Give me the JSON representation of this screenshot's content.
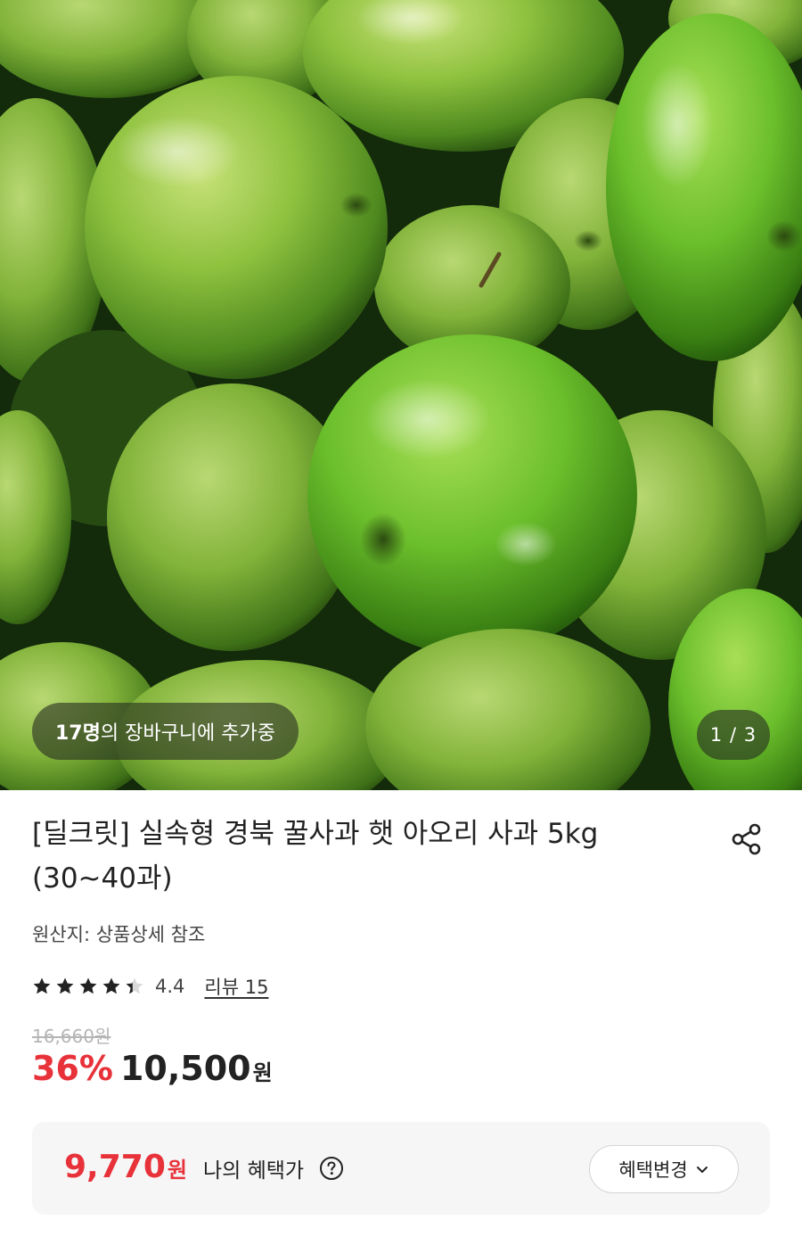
{
  "hero": {
    "image": "green-apples-photo",
    "cart_count": "17명",
    "cart_text": "의 장바구니에 추가중",
    "page_indicator": "1 / 3",
    "current_page": 1,
    "total_pages": 3
  },
  "product": {
    "title_line1": "[딜크릿] 실속형 경북 꿀사과 햇 아오리 사과 5kg",
    "title_line2": "(30~40과)",
    "share_icon": "share-icon",
    "origin": "원산지: 상품상세 참조",
    "rating": {
      "value": "4.4",
      "stars": 4.4,
      "max_stars": 5,
      "review_link": "리뷰 15"
    },
    "price": {
      "original": "16,660원",
      "discount": "36%",
      "sale": "10,500",
      "sale_unit": "원"
    },
    "benefit": {
      "amount": "9,770",
      "unit": "원",
      "label": "나의 혜택가",
      "help_icon": "question-circle-icon",
      "change_button": "혜택변경",
      "change_icon": "chevron-down-icon"
    }
  },
  "colors": {
    "accent": "#e8323a",
    "text": "#222222",
    "muted": "#b5b5b5",
    "box_bg": "#f6f6f7"
  }
}
